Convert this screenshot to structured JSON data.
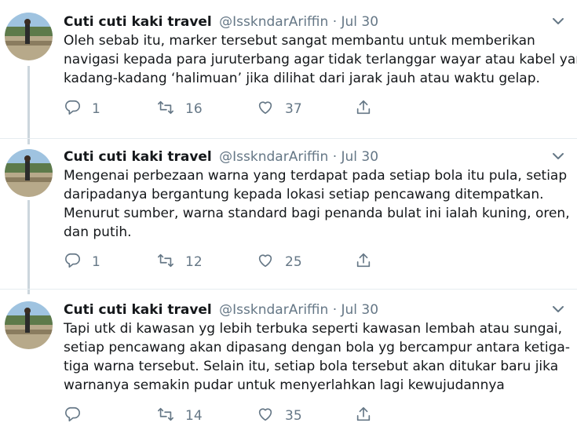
{
  "tweets": [
    {
      "name": "Cuti cuti kaki travel",
      "handle": "@IsskndarAriffin",
      "separator": "·",
      "date": "Jul 30",
      "lines": [
        "Oleh sebab itu, marker tersebut sangat membantu untuk memberikan",
        "navigasi kepada para juruterbang agar tidak terlanggar wayar atau kabel yang",
        "kadang-kadang ‘halimuan’ jika dilihat dari jarak jauh atau waktu gelap."
      ],
      "replies": "1",
      "retweets": "16",
      "likes": "37"
    },
    {
      "name": "Cuti cuti kaki travel",
      "handle": "@IsskndarAriffin",
      "separator": "·",
      "date": "Jul 30",
      "lines": [
        "Mengenai perbezaan warna yang terdapat pada setiap bola itu pula, setiap",
        "daripadanya bergantung kepada lokasi setiap pencawang ditempatkan.",
        "Menurut sumber, warna standard bagi penanda bulat ini ialah kuning, oren,",
        "dan putih."
      ],
      "replies": "1",
      "retweets": "12",
      "likes": "25"
    },
    {
      "name": "Cuti cuti kaki travel",
      "handle": "@IsskndarAriffin",
      "separator": "·",
      "date": "Jul 30",
      "lines": [
        "Tapi utk di kawasan yg lebih terbuka seperti kawasan lembah atau sungai,",
        "setiap pencawang akan dipasang dengan bola yg bercampur antara ketiga-",
        "tiga warna tersebut. Selain itu, setiap bola tersebut akan ditukar baru jika",
        "warnanya semakin pudar untuk menyerlahkan lagi kewujudannya"
      ],
      "replies": "",
      "retweets": "14",
      "likes": "35"
    }
  ],
  "colors": {
    "text": "#14171a",
    "secondary": "#657786",
    "thread_line": "#ccd6dd",
    "divider": "#e6ecf0"
  },
  "icons": [
    "reply-icon",
    "retweet-icon",
    "like-icon",
    "share-icon",
    "chevron-down-icon"
  ]
}
